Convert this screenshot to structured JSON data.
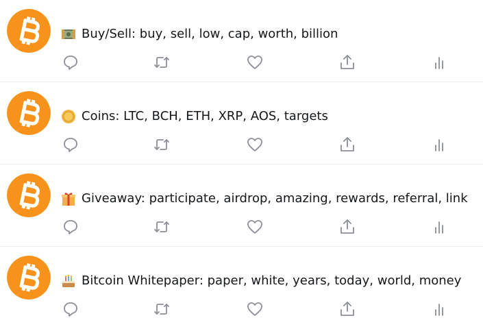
{
  "colors": {
    "bitcoin_orange": "#f7931a",
    "text": "#14171a",
    "icon_gray": "#8b8f95",
    "divider": "#e6ecf0"
  },
  "tweets": [
    {
      "emoji": "money-bag-emoji",
      "text": "Buy/Sell: buy, sell, low, cap, worth, billion"
    },
    {
      "emoji": "coin-emoji",
      "text": "Coins: LTC, BCH, ETH, XRP, AOS, targets"
    },
    {
      "emoji": "gift-emoji",
      "text": "Giveaway: participate, airdrop, amazing, rewards, referral, link"
    },
    {
      "emoji": "cake-emoji",
      "text": "Bitcoin Whitepaper: paper, white, years, today, world, money"
    }
  ],
  "actions": [
    "reply-icon",
    "retweet-icon",
    "like-icon",
    "share-icon",
    "analytics-icon"
  ]
}
